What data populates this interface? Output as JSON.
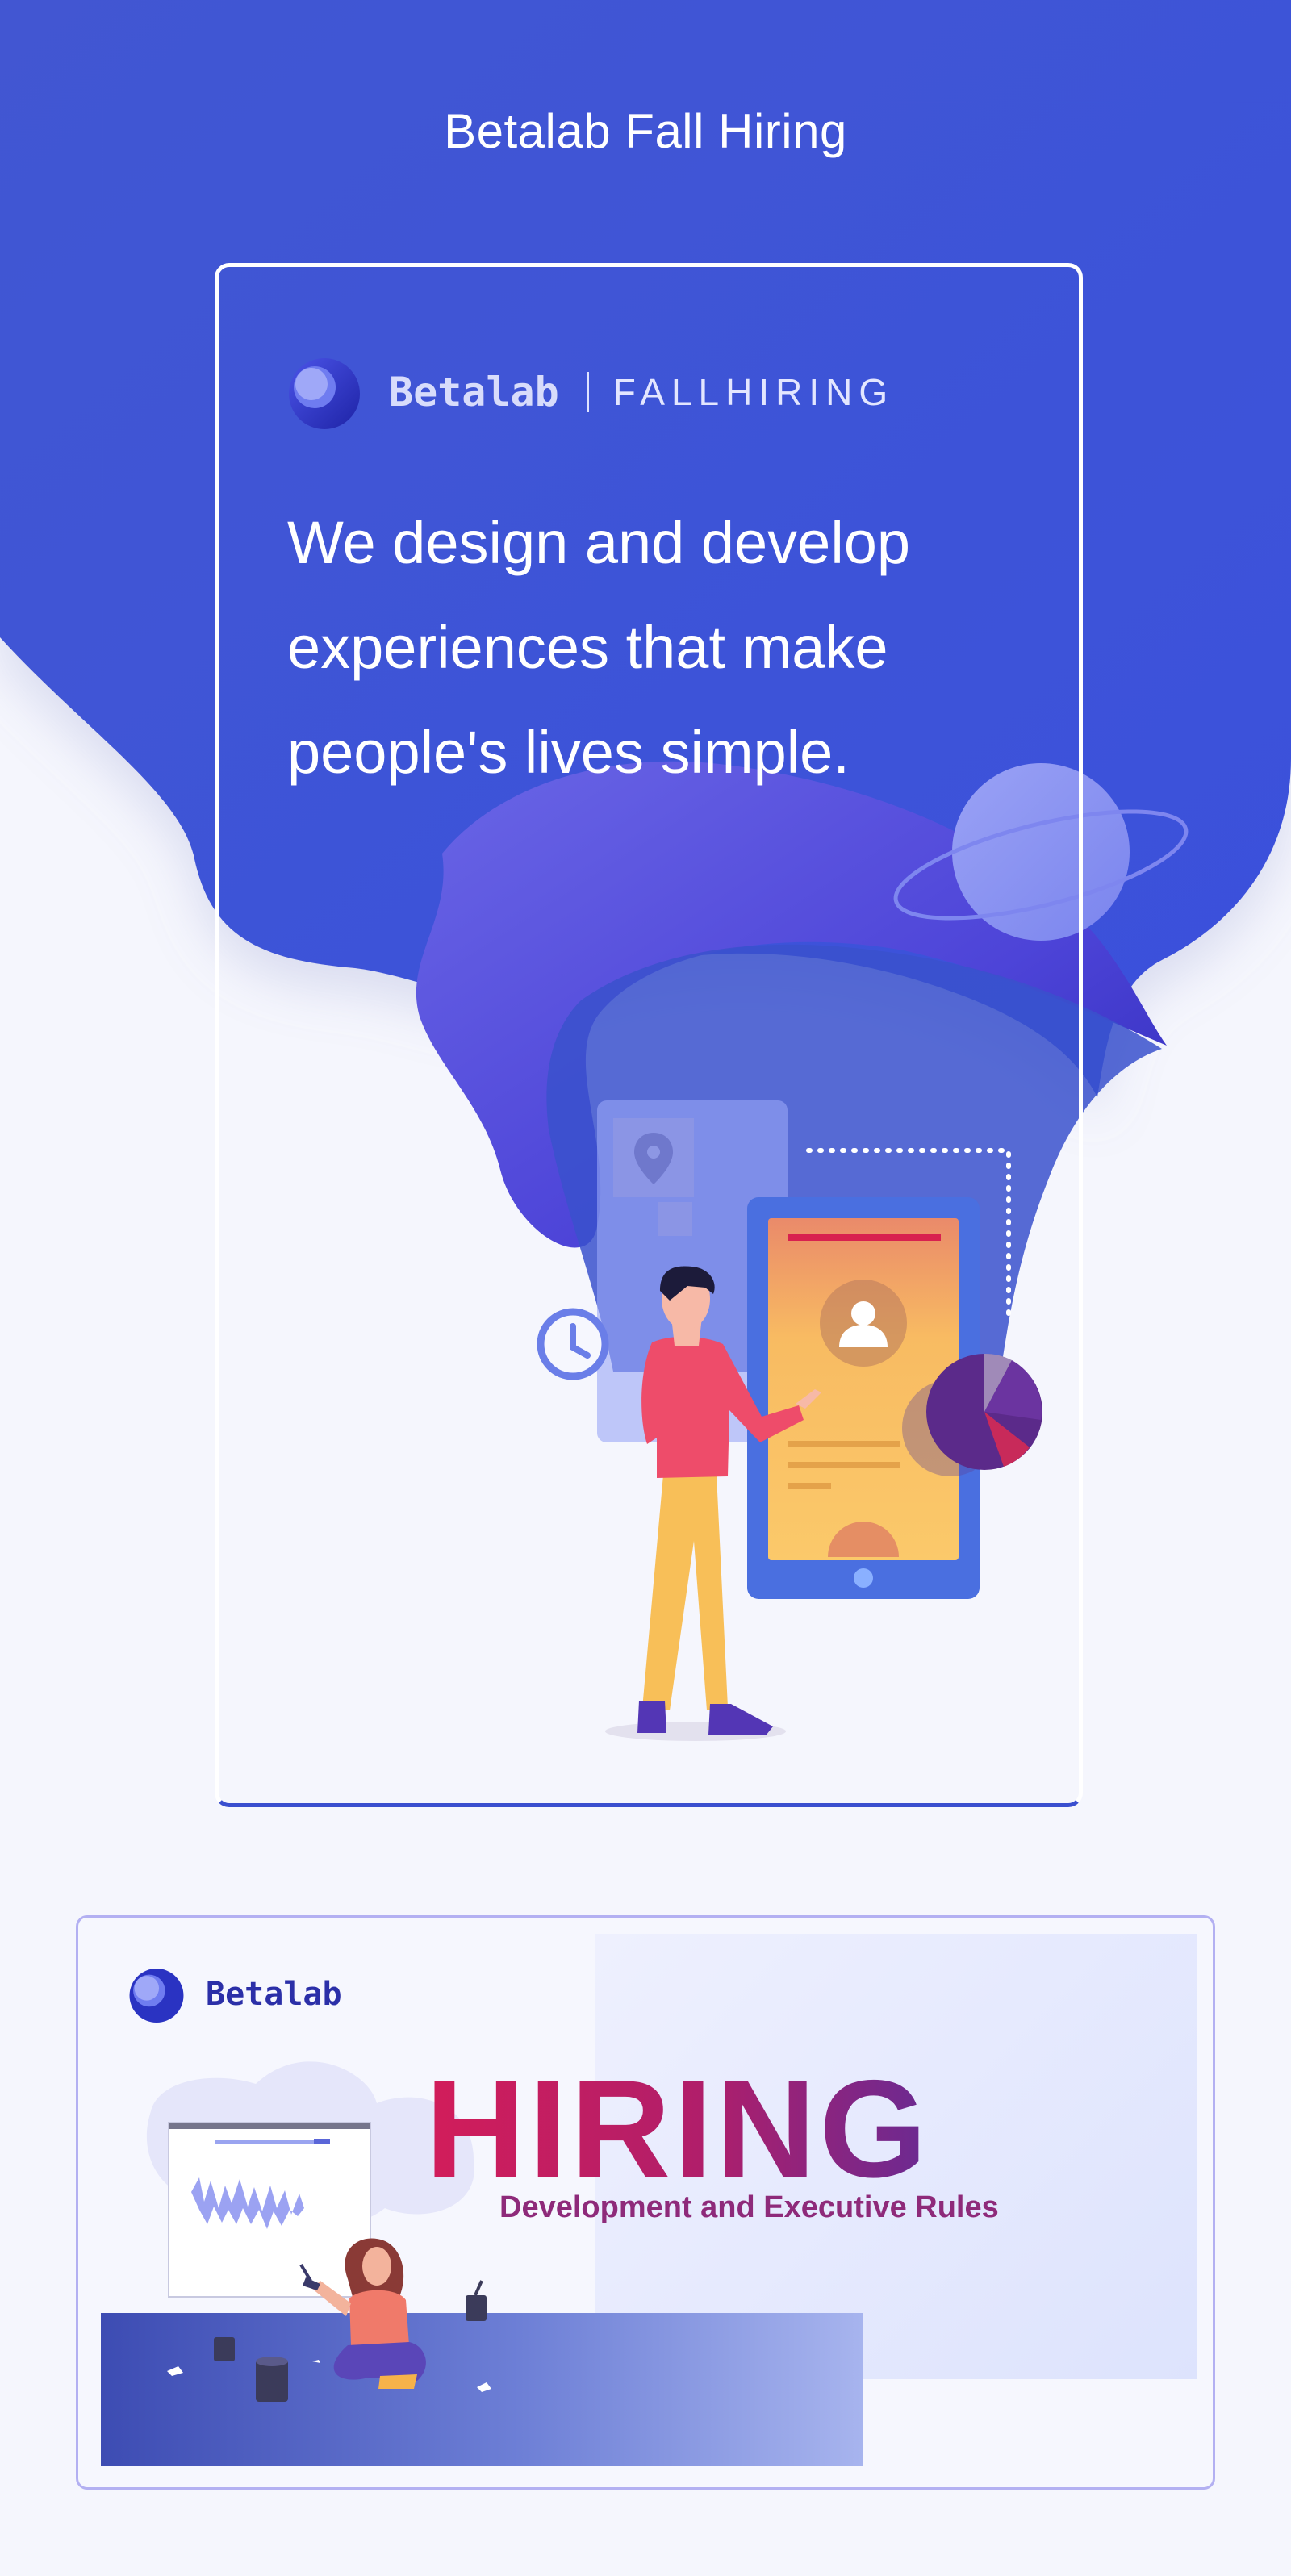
{
  "page": {
    "title": "Betalab Fall Hiring"
  },
  "card1": {
    "brand_name": "Betalab",
    "brand_tag": "FALLHIRING",
    "headline_lines": [
      "We design and develop",
      "experiences that make",
      "people's lives simple."
    ]
  },
  "card2": {
    "brand_name": "Betalab",
    "hiring": "HIRING",
    "subtitle": "Development and Executive Rules"
  },
  "colors": {
    "background": "#f5f6fd",
    "brand_blue": "#3b4fd8",
    "accent_pink": "#d21d5a",
    "accent_purple": "#6a2a92",
    "figure_shirt": "#ee4c6a",
    "figure_pants": "#f8bf58"
  },
  "icons": {
    "logo": "betalab-logo-icon",
    "clock": "clock-icon",
    "location": "map-pin-icon",
    "user": "user-avatar-icon",
    "pie": "pie-chart-icon",
    "planet": "planet-icon"
  }
}
